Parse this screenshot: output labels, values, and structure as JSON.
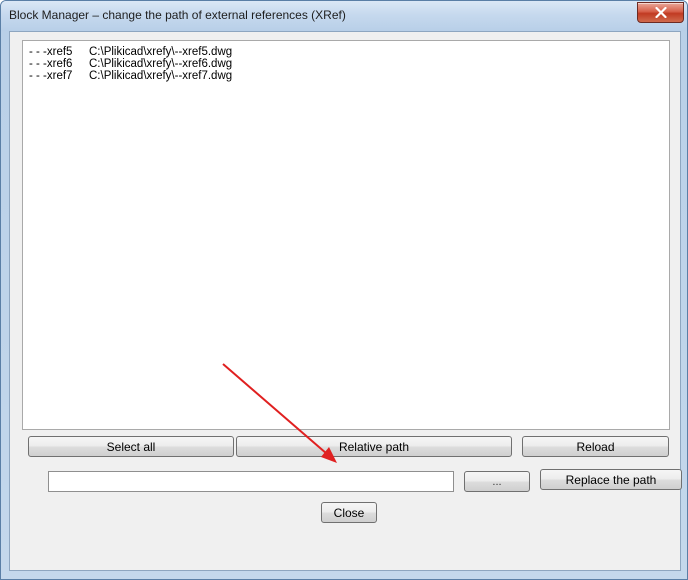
{
  "window": {
    "title": "Block Manager – change the path of external references (XRef)",
    "close_icon": "close-icon"
  },
  "xref_list": [
    {
      "name": "- - -xref5",
      "path": "C:\\Plikicad\\xrefy\\--xref5.dwg"
    },
    {
      "name": "- - -xref6",
      "path": "C:\\Plikicad\\xrefy\\--xref6.dwg"
    },
    {
      "name": "- - -xref7",
      "path": "C:\\Plikicad\\xrefy\\--xref7.dwg"
    }
  ],
  "buttons": {
    "select_all": "Select all",
    "relative_path": "Relative path",
    "reload": "Reload",
    "browse": "...",
    "replace_path": "Replace the path",
    "close": "Close"
  },
  "path_field": {
    "value": "",
    "placeholder": ""
  },
  "annotation": {
    "arrow_color": "#e02020",
    "points_to": "relative-path-button"
  },
  "colors": {
    "title_bar": "#c6d9ee",
    "close_button": "#c9452f",
    "dialog_background": "#f0f0f0"
  }
}
